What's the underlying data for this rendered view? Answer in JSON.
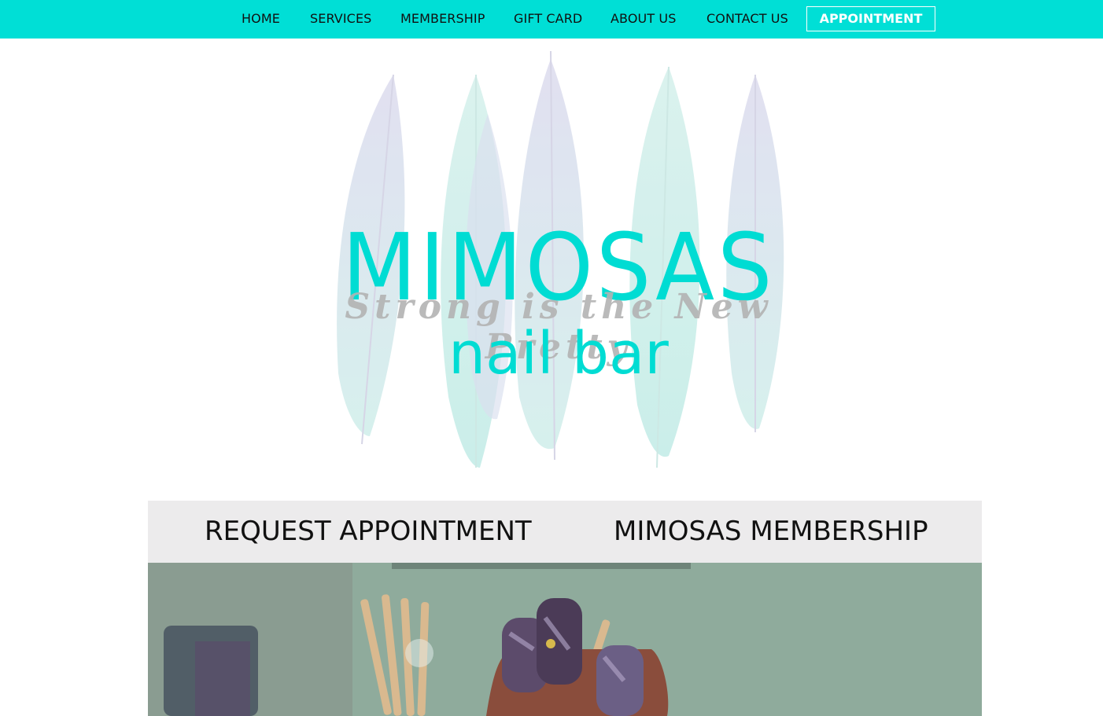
{
  "nav": {
    "items": [
      "HOME",
      "SERVICES",
      "MEMBERSHIP",
      "GIFT CARD",
      "ABOUT US",
      "CONTACT US"
    ],
    "appointment": "APPOINTMENT"
  },
  "logo": {
    "title": "MIMOSAS",
    "tagline": "Strong is the New Pretty",
    "subtitle": "nail bar"
  },
  "cta": {
    "left": "REQUEST APPOINTMENT",
    "right": "MIMOSAS MEMBERSHIP"
  },
  "colors": {
    "accent": "#00dfd6",
    "cta_bar": "#ecebec",
    "tagline": "#b3b3b3"
  },
  "icons": {
    "hero": "feather-icon",
    "photo": "nail-art-photo"
  }
}
